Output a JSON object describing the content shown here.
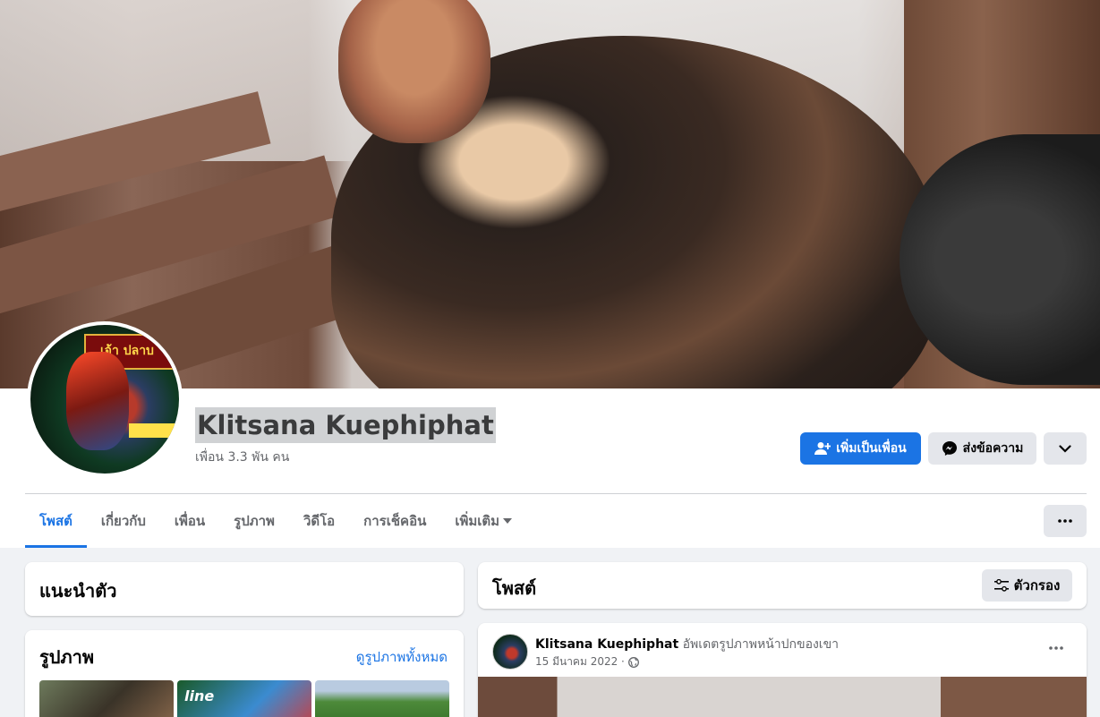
{
  "profile": {
    "name": "Klitsana Kuephiphat",
    "friends": "เพื่อน 3.3 พัน คน",
    "avatar_text": "เจ้า ปลาบ"
  },
  "actions": {
    "add_friend": "เพิ่มเป็นเพื่อน",
    "message": "ส่งข้อความ"
  },
  "tabs": [
    {
      "label": "โพสต์"
    },
    {
      "label": "เกี่ยวกับ"
    },
    {
      "label": "เพื่อน"
    },
    {
      "label": "รูปภาพ"
    },
    {
      "label": "วิดีโอ"
    },
    {
      "label": "การเช็คอิน"
    },
    {
      "label": "เพิ่มเติม"
    }
  ],
  "intro": {
    "title": "แนะนำตัว"
  },
  "photos": {
    "title": "รูปภาพ",
    "see_all": "ดูรูปภาพทั้งหมด",
    "thumb2_text": "line"
  },
  "posts": {
    "title": "โพสต์",
    "filter": "ตัวกรอง"
  },
  "post": {
    "author": "Klitsana Kuephiphat",
    "action": "อัพเดตรูปภาพหน้าปกของเขา",
    "date": "15 มีนาคม 2022 ·"
  },
  "colors": {
    "accent": "#1b74e4",
    "button_gray": "#e4e6eb",
    "background": "#f0f2f5"
  },
  "icons": [
    "add-friend-icon",
    "messenger-icon",
    "chevron-down-icon",
    "more-dots-icon",
    "filter-icon",
    "globe-icon",
    "caret-down-icon"
  ]
}
